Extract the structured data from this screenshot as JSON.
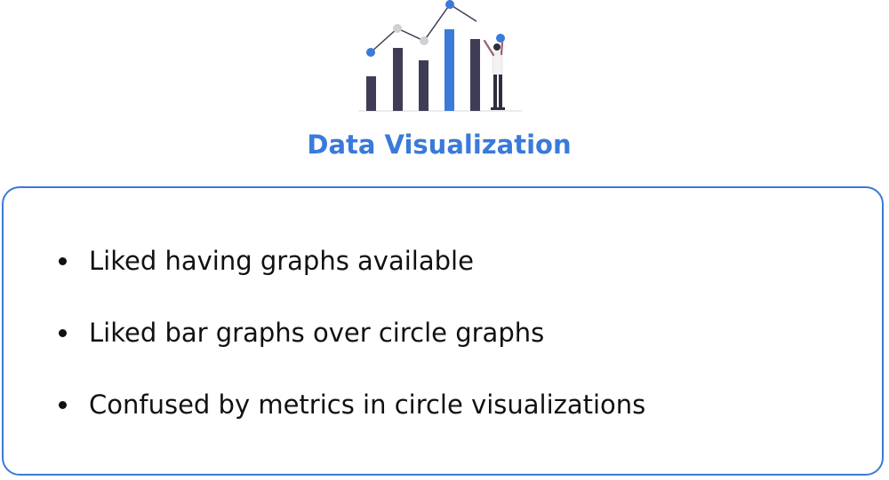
{
  "illustration": {
    "icon": "data-visualization-illustration",
    "colors": {
      "bar_dark": "#3f3d56",
      "bar_accent": "#3a7ad9",
      "dot_blue": "#3a7ad9",
      "dot_gray": "#d0d0d0",
      "line": "#3f3d56"
    }
  },
  "title": "Data Visualization",
  "accent_color": "#3a7ad9",
  "bullets": [
    "Liked having graphs available",
    "Liked bar graphs over circle graphs",
    "Confused by metrics in circle visualizations"
  ]
}
